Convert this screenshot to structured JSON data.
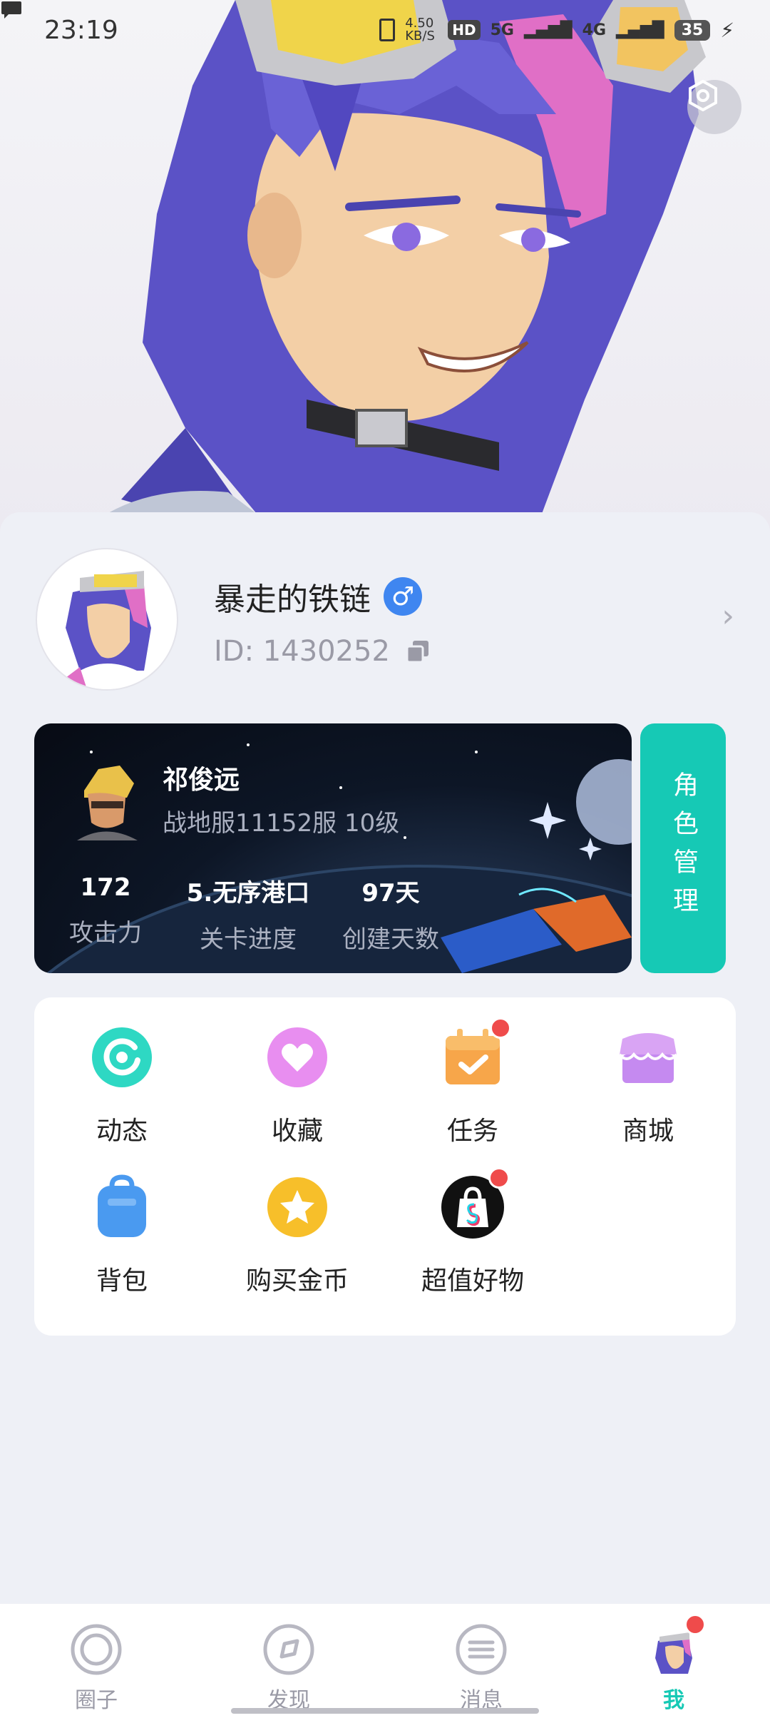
{
  "status_bar": {
    "time": "23:19",
    "net_speed": "4.50 KB/S",
    "hd_label": "HD",
    "sim1_label": "5G",
    "sim2_label": "4G",
    "battery": "35"
  },
  "profile": {
    "username": "暴走的铁链",
    "gender_symbol": "♂",
    "user_id": "ID: 1430252"
  },
  "role_card": {
    "name": "祁俊远",
    "server_level": "战地服11152服  10级",
    "stats": [
      {
        "value": "172",
        "label": "攻击力"
      },
      {
        "value": "5.无序港口",
        "label": "关卡进度"
      },
      {
        "value": "97天",
        "label": "创建天数"
      }
    ],
    "manage_label": "角色管理"
  },
  "menu": {
    "items": [
      {
        "label": "动态",
        "icon": "activity-icon",
        "color": "#2ed8c3",
        "badge": false
      },
      {
        "label": "收藏",
        "icon": "heart-icon",
        "color": "#e88ef0",
        "badge": false
      },
      {
        "label": "任务",
        "icon": "calendar-check-icon",
        "color": "#f7a64a",
        "badge": true
      },
      {
        "label": "商城",
        "icon": "store-icon",
        "color": "#c58af0",
        "badge": false
      },
      {
        "label": "背包",
        "icon": "backpack-icon",
        "color": "#4a9af0",
        "badge": false
      },
      {
        "label": "购买金币",
        "icon": "coin-star-icon",
        "color": "#f7bf2a",
        "badge": false
      },
      {
        "label": "超值好物",
        "icon": "shopping-bag-icon",
        "color": "#111111",
        "badge": true
      }
    ]
  },
  "bottom_nav": {
    "items": [
      {
        "label": "圈子",
        "active": false
      },
      {
        "label": "发现",
        "active": false
      },
      {
        "label": "消息",
        "active": false
      },
      {
        "label": "我",
        "active": true
      }
    ]
  },
  "colors": {
    "accent": "#16c9b5",
    "badge_red": "#ef4b4b",
    "gender_blue": "#3f86f0"
  }
}
